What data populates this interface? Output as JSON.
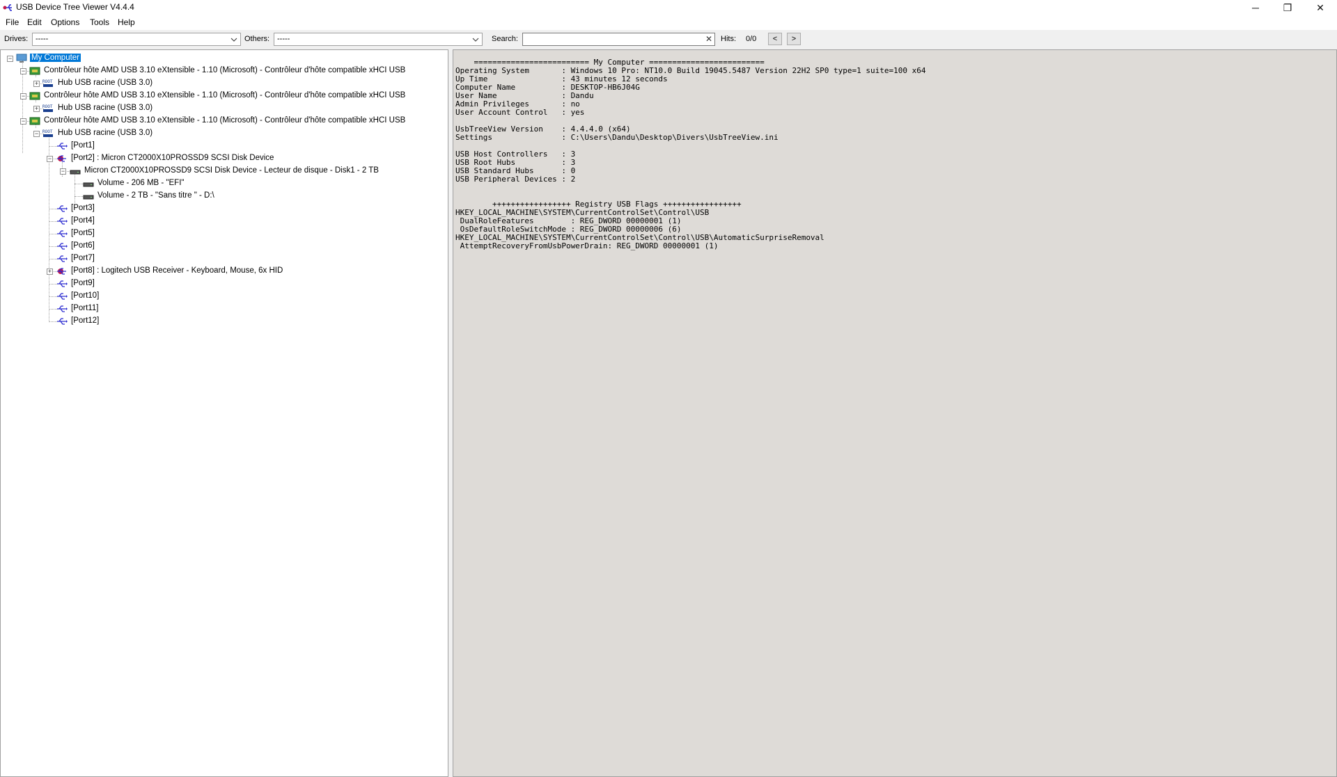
{
  "window": {
    "title": "USB Device Tree Viewer V4.4.4",
    "minimize_glyph": "─",
    "maximize_glyph": "❐",
    "close_glyph": "✕"
  },
  "menu": [
    "File",
    "Edit",
    "Options",
    "Tools",
    "Help"
  ],
  "toolbar": {
    "drives_label": "Drives:",
    "drives_value": "-----",
    "others_label": "Others:",
    "others_value": "-----",
    "search_label": "Search:",
    "search_value": "",
    "hits_label": "Hits:",
    "hits_value": "0/0",
    "prev_label": "<",
    "next_label": ">"
  },
  "tree": [
    {
      "label": "My Computer",
      "icon": "computer-icon",
      "expander": "−"
    },
    {
      "label": "Contrôleur hôte AMD USB 3.10 eXtensible - 1.10 (Microsoft) - Contrôleur d'hôte compatible xHCI USB",
      "icon": "controller-icon",
      "expander": "−"
    },
    {
      "label": "Hub USB racine (USB 3.0)",
      "icon": "root-hub-icon",
      "expander": "+"
    },
    {
      "label": "Contrôleur hôte AMD USB 3.10 eXtensible - 1.10 (Microsoft) - Contrôleur d'hôte compatible xHCI USB",
      "icon": "controller-icon",
      "expander": "−"
    },
    {
      "label": "Hub USB racine (USB 3.0)",
      "icon": "root-hub-icon",
      "expander": "+"
    },
    {
      "label": "Contrôleur hôte AMD USB 3.10 eXtensible - 1.10 (Microsoft) - Contrôleur d'hôte compatible xHCI USB",
      "icon": "controller-icon",
      "expander": "−"
    },
    {
      "label": "Hub USB racine (USB 3.0)",
      "icon": "root-hub-icon",
      "expander": "−"
    },
    {
      "label": "[Port1]",
      "icon": "usb-port-icon",
      "expander": ""
    },
    {
      "label": "[Port2] : Micron CT2000X10PROSSD9 SCSI Disk Device",
      "icon": "usb-device-icon",
      "expander": "−"
    },
    {
      "label": "Micron CT2000X10PROSSD9 SCSI Disk Device - Lecteur de disque - Disk1 - 2 TB",
      "icon": "disk-icon",
      "expander": "−"
    },
    {
      "label": "Volume - 206 MB - \"EFI\"",
      "icon": "volume-icon",
      "expander": ""
    },
    {
      "label": "Volume - 2 TB - \"Sans titre \" - D:\\",
      "icon": "volume-icon",
      "expander": ""
    },
    {
      "label": "[Port3]",
      "icon": "usb-port-icon",
      "expander": ""
    },
    {
      "label": "[Port4]",
      "icon": "usb-port-icon",
      "expander": ""
    },
    {
      "label": "[Port5]",
      "icon": "usb-port-icon",
      "expander": ""
    },
    {
      "label": "[Port6]",
      "icon": "usb-port-icon",
      "expander": ""
    },
    {
      "label": "[Port7]",
      "icon": "usb-port-icon",
      "expander": ""
    },
    {
      "label": "[Port8] : Logitech USB Receiver - Keyboard, Mouse, 6x HID",
      "icon": "usb-device-icon",
      "expander": "+"
    },
    {
      "label": "[Port9]",
      "icon": "usb-port-icon",
      "expander": ""
    },
    {
      "label": "[Port10]",
      "icon": "usb-port-icon",
      "expander": ""
    },
    {
      "label": "[Port11]",
      "icon": "usb-port-icon",
      "expander": ""
    },
    {
      "label": "[Port12]",
      "icon": "usb-port-icon",
      "expander": ""
    }
  ],
  "report": [
    "    ========================= My Computer =========================",
    "Operating System       : Windows 10 Pro: NT10.0 Build 19045.5487 Version 22H2 SP0 type=1 suite=100 x64",
    "Up Time                : 43 minutes 12 seconds",
    "Computer Name          : DESKTOP-HB6J04G",
    "User Name              : Dandu",
    "Admin Privileges       : no",
    "User Account Control   : yes",
    "",
    "UsbTreeView Version    : 4.4.4.0 (x64)",
    "Settings               : C:\\Users\\Dandu\\Desktop\\Divers\\UsbTreeView.ini",
    "",
    "USB Host Controllers   : 3",
    "USB Root Hubs          : 3",
    "USB Standard Hubs      : 0",
    "USB Peripheral Devices : 2",
    "",
    "",
    "        +++++++++++++++++ Registry USB Flags +++++++++++++++++",
    "HKEY_LOCAL_MACHINE\\SYSTEM\\CurrentControlSet\\Control\\USB",
    " DualRoleFeatures        : REG_DWORD 00000001 (1)",
    " OsDefaultRoleSwitchMode : REG_DWORD 00000006 (6)",
    "HKEY_LOCAL_MACHINE\\SYSTEM\\CurrentControlSet\\Control\\USB\\AutomaticSurpriseRemoval",
    " AttemptRecoveryFromUsbPowerDrain: REG_DWORD 00000001 (1)"
  ]
}
